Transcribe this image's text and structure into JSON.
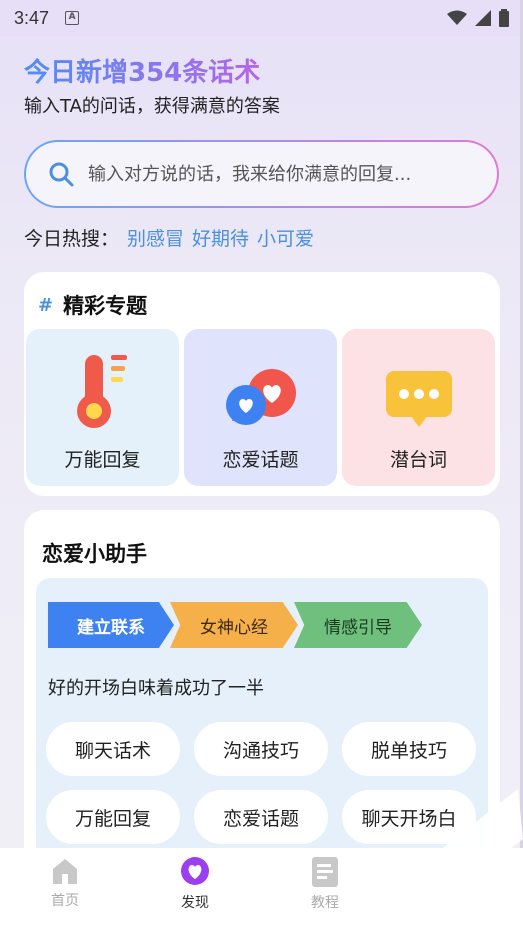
{
  "status": {
    "time": "3:47",
    "notification_letter": "A"
  },
  "header": {
    "headline": "今日新增354条话术",
    "subtitle": "输入TA的问话，获得满意的答案"
  },
  "search": {
    "placeholder": "输入对方说的话，我来给你满意的回复..."
  },
  "hot": {
    "label": "今日热搜：",
    "tags": [
      "别感冒",
      "好期待",
      "小可爱"
    ]
  },
  "topics": {
    "title": "精彩专题",
    "items": [
      {
        "label": "万能回复",
        "icon": "thermometer-icon"
      },
      {
        "label": "恋爱话题",
        "icon": "chat-hearts-icon"
      },
      {
        "label": "潜台词",
        "icon": "message-dots-icon"
      }
    ]
  },
  "assistant": {
    "title": "恋爱小助手",
    "steps": [
      "建立联系",
      "女神心经",
      "情感引导"
    ],
    "tip": "好的开场白味着成功了一半",
    "chips": [
      "聊天话术",
      "沟通技巧",
      "脱单技巧",
      "万能回复",
      "恋爱话题",
      "聊天开场白"
    ]
  },
  "nav": {
    "items": [
      {
        "label": "首页",
        "icon": "home-icon"
      },
      {
        "label": "发现",
        "icon": "discover-heart-icon"
      },
      {
        "label": "教程",
        "icon": "document-icon"
      }
    ]
  },
  "colors": {
    "accent": "#4a90e2",
    "headline_start": "#4f8df7",
    "headline_end": "#b565e8"
  }
}
